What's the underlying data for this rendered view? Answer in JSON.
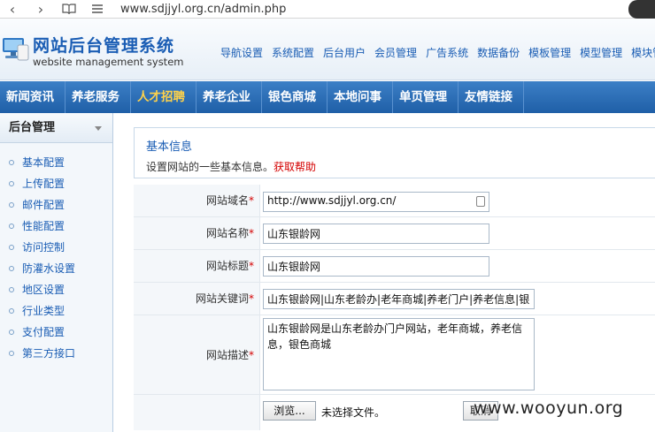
{
  "browser": {
    "url": "www.sdjjyl.org.cn/admin.php"
  },
  "header": {
    "title": "网站后台管理系统",
    "subtitle": "website management system",
    "links": [
      "导航设置",
      "系统配置",
      "后台用户",
      "会员管理",
      "广告系统",
      "数据备份",
      "模板管理",
      "模型管理",
      "模块管"
    ]
  },
  "mainnav": {
    "items": [
      "新闻资讯",
      "养老服务",
      "人才招聘",
      "养老企业",
      "银色商城",
      "本地问事",
      "单页管理",
      "友情链接"
    ],
    "active_index": 2,
    "active_color": "#ffd24a"
  },
  "sidebar": {
    "title": "后台管理",
    "items": [
      "基本配置",
      "上传配置",
      "邮件配置",
      "性能配置",
      "访问控制",
      "防灌水设置",
      "地区设置",
      "行业类型",
      "支付配置",
      "第三方接口"
    ]
  },
  "info": {
    "title": "基本信息",
    "desc": "设置网站的一些基本信息。",
    "help": "获取帮助"
  },
  "form": {
    "required_mark": "*",
    "domain_label": "网站域名",
    "domain_value": "http://www.sdjjyl.org.cn/",
    "name_label": "网站名称",
    "name_value": "山东银龄网",
    "title_label": "网站标题",
    "title_value": "山东银龄网",
    "keywords_label": "网站关键词",
    "keywords_value": "山东银龄网|山东老龄办|老年商城|养老门户|养老信息|银",
    "desc_label": "网站描述",
    "desc_value": "山东银龄网是山东老龄办门户网站，老年商城，养老信息，银色商城",
    "browse_label": "浏览...",
    "no_file_label": "未选择文件。",
    "cancel_label": "取消"
  },
  "watermark": "www.wooyun.org"
}
